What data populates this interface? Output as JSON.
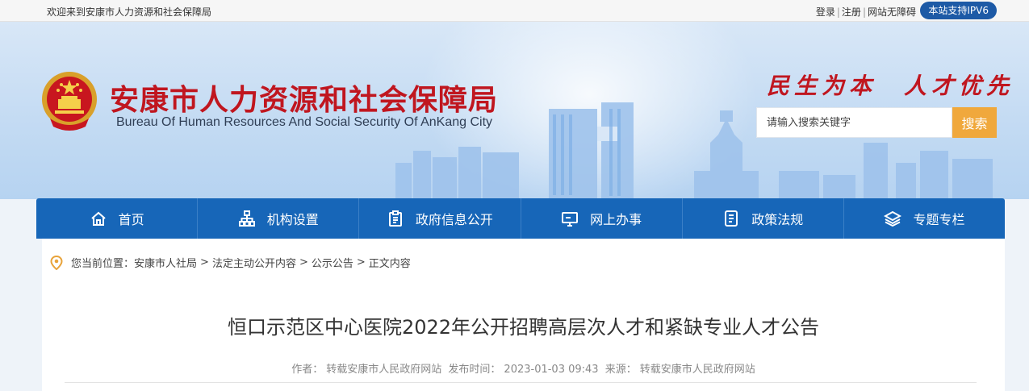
{
  "topbar": {
    "welcome": "欢迎来到安康市人力资源和社会保障局",
    "login": "登录",
    "register": "注册",
    "accessible": "网站无障碍",
    "ipv6": "本站支持IPV6"
  },
  "header": {
    "title_cn": "安康市人力资源和社会保障局",
    "title_en": "Bureau Of Human Resources And Social Security Of AnKang City",
    "slogan": "民生为本　人才优先",
    "search_placeholder": "请输入搜索关键字",
    "search_button": "搜索"
  },
  "nav": {
    "items": [
      {
        "label": "首页",
        "icon": "home-icon"
      },
      {
        "label": "机构设置",
        "icon": "org-chart-icon"
      },
      {
        "label": "政府信息公开",
        "icon": "clipboard-icon"
      },
      {
        "label": "网上办事",
        "icon": "monitor-icon"
      },
      {
        "label": "政策法规",
        "icon": "document-icon"
      },
      {
        "label": "专题专栏",
        "icon": "layers-icon"
      }
    ]
  },
  "breadcrumb": {
    "prefix": "您当前位置：",
    "items": [
      "安康市人社局",
      "法定主动公开内容",
      "公示公告",
      "正文内容"
    ],
    "separator": ">"
  },
  "article": {
    "title": "恒口示范区中心医院2022年公开招聘高层次人才和紧缺专业人才公告",
    "author_label": "作者：",
    "author": "转载安康市人民政府网站",
    "date_label": "发布时间：",
    "date": "2023-01-03 09:43",
    "source_label": "来源：",
    "source": "转载安康市人民政府网站"
  },
  "colors": {
    "brand_red": "#c0161f",
    "nav_blue": "#1766b8",
    "search_orange": "#f0a83c",
    "ipv6_blue": "#1d5aa6"
  }
}
